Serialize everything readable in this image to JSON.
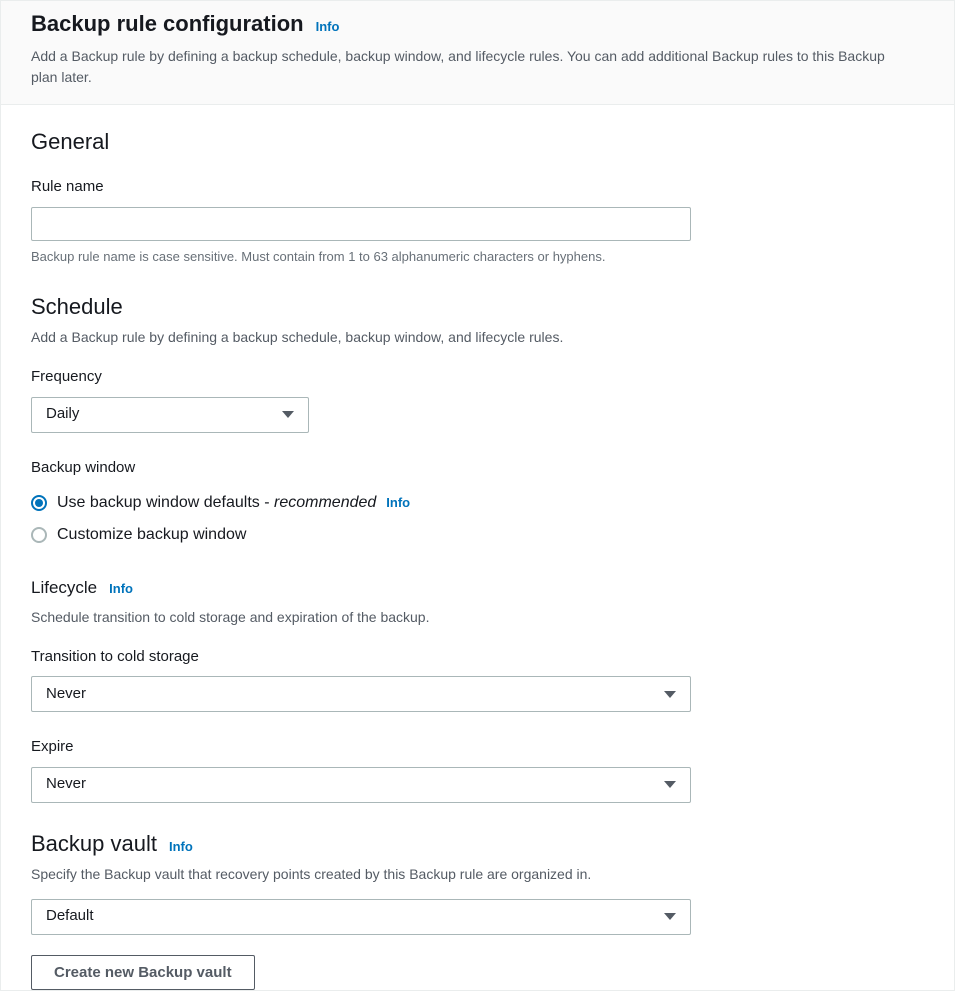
{
  "header": {
    "title": "Backup rule configuration",
    "info": "Info",
    "description": "Add a Backup rule by defining a backup schedule, backup window, and lifecycle rules. You can add additional Backup rules to this Backup plan later."
  },
  "general": {
    "title": "General",
    "rule_name_label": "Rule name",
    "rule_name_value": "",
    "rule_name_hint": "Backup rule name is case sensitive. Must contain from 1 to 63 alphanumeric characters or hyphens."
  },
  "schedule": {
    "title": "Schedule",
    "description": "Add a Backup rule by defining a backup schedule, backup window, and lifecycle rules.",
    "frequency_label": "Frequency",
    "frequency_value": "Daily",
    "backup_window_label": "Backup window",
    "options": {
      "defaults": "Use backup window defaults",
      "defaults_suffix_sep": "- ",
      "defaults_suffix": "recommended",
      "defaults_info": "Info",
      "customize": "Customize backup window"
    }
  },
  "lifecycle": {
    "title": "Lifecycle",
    "info": "Info",
    "description": "Schedule transition to cold storage and expiration of the backup.",
    "cold_label": "Transition to cold storage",
    "cold_value": "Never",
    "expire_label": "Expire",
    "expire_value": "Never"
  },
  "vault": {
    "title": "Backup vault",
    "info": "Info",
    "description": "Specify the Backup vault that recovery points created by this Backup rule are organized in.",
    "value": "Default",
    "create_button": "Create new Backup vault"
  }
}
